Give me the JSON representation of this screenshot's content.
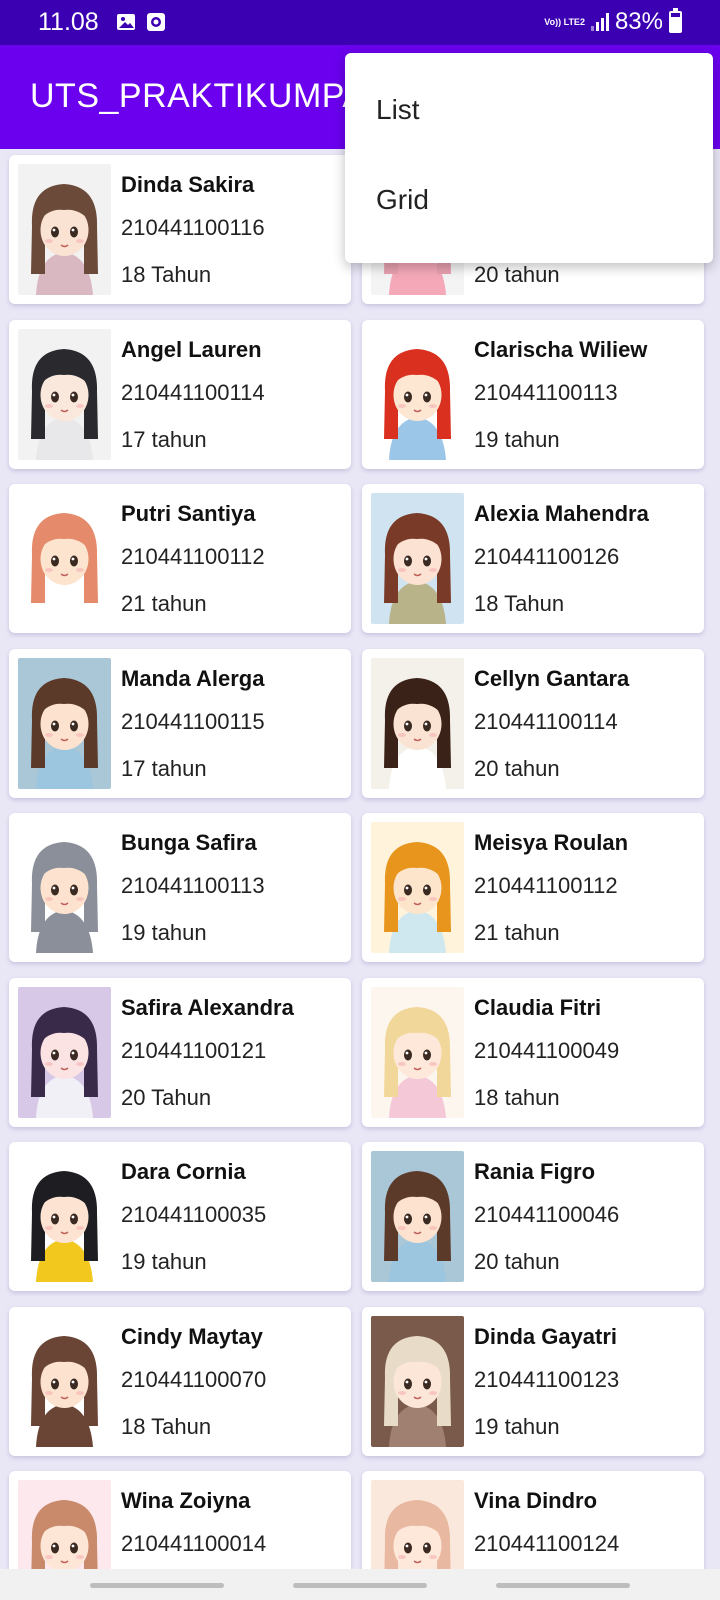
{
  "status_bar": {
    "time": "11.08",
    "network": "Vo)) LTE2",
    "battery": "83%"
  },
  "app_bar": {
    "title": "UTS_PRAKTIKUMPAPB"
  },
  "overflow_menu": {
    "items": [
      "List",
      "Grid"
    ]
  },
  "students": [
    {
      "name": "Dinda Sakira",
      "nim": "210441100116",
      "age": "18 Tahun",
      "avatar": "girl-bun-pink"
    },
    {
      "name": "",
      "nim": "",
      "age": "20 tahun",
      "avatar": "girl-pink-dress"
    },
    {
      "name": "Angel Lauren",
      "nim": "210441100114",
      "age": "17 tahun",
      "avatar": "girl-black-hair"
    },
    {
      "name": "Clarischa Wiliew",
      "nim": "210441100113",
      "age": "19 tahun",
      "avatar": "girl-red-hair"
    },
    {
      "name": "Putri Santiya",
      "nim": "210441100112",
      "age": "21 tahun",
      "avatar": "girl-pigtails"
    },
    {
      "name": "Alexia Mahendra",
      "nim": "210441100126",
      "age": "18 Tahun",
      "avatar": "girl-brown-long"
    },
    {
      "name": "Manda Alerga",
      "nim": "210441100115",
      "age": "17 tahun",
      "avatar": "girl-cap-blue"
    },
    {
      "name": "Cellyn Gantara",
      "nim": "210441100114",
      "age": "20 tahun",
      "avatar": "girl-dark-bob"
    },
    {
      "name": "Bunga Safira",
      "nim": "210441100113",
      "age": "19 tahun",
      "avatar": "child-bunny-hood"
    },
    {
      "name": "Meisya Roulan",
      "nim": "210441100112",
      "age": "21 tahun",
      "avatar": "girl-orange-hair"
    },
    {
      "name": "Safira Alexandra",
      "nim": "210441100121",
      "age": "20 Tahun",
      "avatar": "girl-purple-hood"
    },
    {
      "name": "Claudia Fitri",
      "nim": "210441100049",
      "age": "18 tahun",
      "avatar": "girl-blonde-bow"
    },
    {
      "name": "Dara Cornia",
      "nim": "210441100035",
      "age": "19 tahun",
      "avatar": "girl-yellow-winking"
    },
    {
      "name": "Rania Figro",
      "nim": "210441100046",
      "age": "20 tahun",
      "avatar": "girl-cap-blue"
    },
    {
      "name": "Cindy Maytay",
      "nim": "210441100070",
      "age": "18 Tahun",
      "avatar": "girl-cat-ears"
    },
    {
      "name": "Dinda Gayatri",
      "nim": "210441100123",
      "age": "19 tahun",
      "avatar": "girl-pale-winking"
    },
    {
      "name": "Wina Zoiyna",
      "nim": "210441100014",
      "age": "",
      "avatar": "girl-pink-bow"
    },
    {
      "name": "Vina Dindro",
      "nim": "210441100124",
      "age": "",
      "avatar": "girl-peach"
    }
  ],
  "colors": {
    "status_bar": "#3c00b3",
    "app_bar": "#6a00ee",
    "background": "#e9e6f6",
    "card": "#ffffff"
  }
}
